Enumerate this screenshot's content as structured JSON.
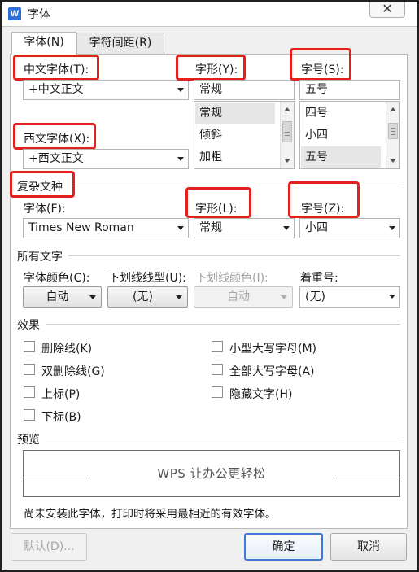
{
  "window": {
    "title": "字体",
    "app_icon": "W",
    "close_glyph": "✕"
  },
  "tabs": [
    {
      "label": "字体(N)"
    },
    {
      "label": "字符间距(R)"
    }
  ],
  "chinese": {
    "font_label": "中文字体(T):",
    "font_value": "+中文正文",
    "style_label": "字形(Y):",
    "style_value": "常规",
    "style_items": [
      "常规",
      "倾斜",
      "加粗"
    ],
    "size_label": "字号(S):",
    "size_value": "五号",
    "size_items": [
      "四号",
      "小四",
      "五号"
    ]
  },
  "western": {
    "font_label": "西文字体(X):",
    "font_value": "+西文正文"
  },
  "complex": {
    "section_label": "复杂文种",
    "font_label": "字体(F):",
    "font_value": "Times New Roman",
    "style_label": "字形(L):",
    "style_value": "常规",
    "size_label": "字号(Z):",
    "size_value": "小四"
  },
  "all_text": {
    "section_label": "所有文字",
    "color_label": "字体颜色(C):",
    "color_value": "自动",
    "underline_label": "下划线线型(U):",
    "underline_value": "(无)",
    "underline_color_label": "下划线颜色(I):",
    "underline_color_value": "自动",
    "emphasis_label": "着重号:",
    "emphasis_value": "(无)"
  },
  "effects": {
    "section_label": "效果",
    "left": [
      "删除线(K)",
      "双删除线(G)",
      "上标(P)",
      "下标(B)"
    ],
    "right": [
      "小型大写字母(M)",
      "全部大写字母(A)",
      "隐藏文字(H)"
    ]
  },
  "preview": {
    "section_label": "预览",
    "sample_text": "WPS 让办公更轻松",
    "note": "尚未安装此字体，打印时将采用最相近的有效字体。"
  },
  "buttons": {
    "default": "默认(D)...",
    "ok": "确定",
    "cancel": "取消"
  },
  "colors": {
    "highlight": "#e3201b",
    "primary_border": "#3d7bd6",
    "app_icon": "#2b6fd6"
  }
}
